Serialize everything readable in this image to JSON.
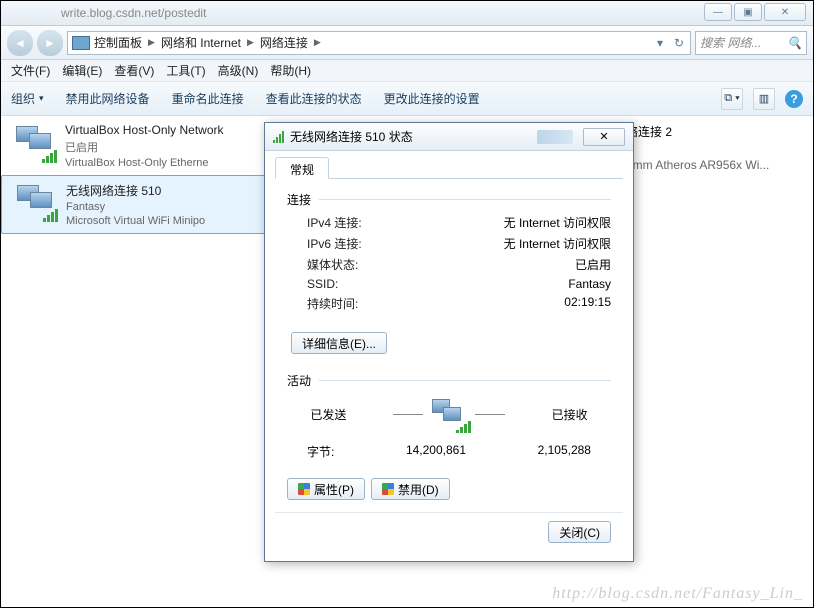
{
  "browser_url": "write.blog.csdn.net/postedit",
  "winbuttons": {
    "min": "—",
    "max": "▣",
    "close": "✕"
  },
  "breadcrumb": [
    "控制面板",
    "网络和 Internet",
    "网络连接"
  ],
  "search_placeholder": "搜索 网络...",
  "menubar": [
    "文件(F)",
    "编辑(E)",
    "查看(V)",
    "工具(T)",
    "高级(N)",
    "帮助(H)"
  ],
  "cmdbar": {
    "organize": "组织",
    "actions": [
      "禁用此网络设备",
      "重命名此连接",
      "查看此连接的状态",
      "更改此连接的设置"
    ]
  },
  "connections": [
    {
      "name": "VirtualBox Host-Only Network",
      "status": "已启用",
      "device": "VirtualBox Host-Only Etherne"
    },
    {
      "name": "无线网络连接 510",
      "status": "Fantasy",
      "device": "Microsoft Virtual WiFi Minipo"
    }
  ],
  "right_item": {
    "name": "络连接 2",
    "device": "omm Atheros AR956x Wi..."
  },
  "dialog": {
    "title": "无线网络连接 510 状态",
    "tab": "常规",
    "conn_group": "连接",
    "rows": {
      "ipv4_k": "IPv4 连接:",
      "ipv4_v": "无 Internet 访问权限",
      "ipv6_k": "IPv6 连接:",
      "ipv6_v": "无 Internet 访问权限",
      "media_k": "媒体状态:",
      "media_v": "已启用",
      "ssid_k": "SSID:",
      "ssid_v": "Fantasy",
      "dur_k": "持续时间:",
      "dur_v": "02:19:15"
    },
    "details_btn": "详细信息(E)...",
    "activity_group": "活动",
    "sent_label": "已发送",
    "recv_label": "已接收",
    "bytes_label": "字节:",
    "bytes_sent": "14,200,861",
    "bytes_recv": "2,105,288",
    "properties_btn": "属性(P)",
    "disable_btn": "禁用(D)",
    "close_btn": "关闭(C)"
  },
  "watermark": "http://blog.csdn.net/Fantasy_Lin_"
}
